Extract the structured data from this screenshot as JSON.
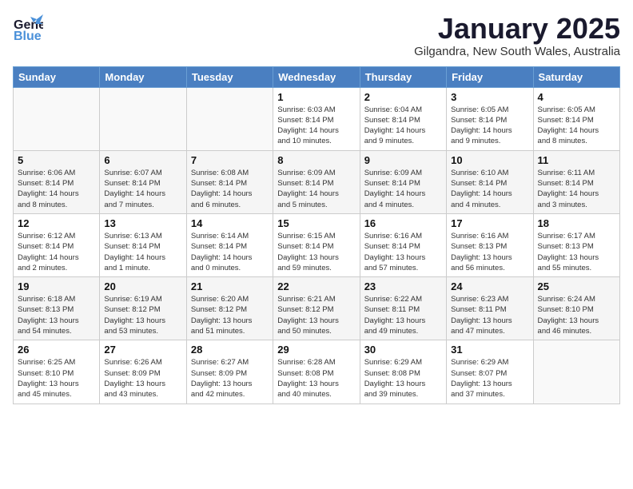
{
  "header": {
    "logo_line1": "General",
    "logo_line2": "Blue",
    "month": "January 2025",
    "location": "Gilgandra, New South Wales, Australia"
  },
  "weekdays": [
    "Sunday",
    "Monday",
    "Tuesday",
    "Wednesday",
    "Thursday",
    "Friday",
    "Saturday"
  ],
  "weeks": [
    [
      {
        "day": "",
        "info": ""
      },
      {
        "day": "",
        "info": ""
      },
      {
        "day": "",
        "info": ""
      },
      {
        "day": "1",
        "info": "Sunrise: 6:03 AM\nSunset: 8:14 PM\nDaylight: 14 hours\nand 10 minutes."
      },
      {
        "day": "2",
        "info": "Sunrise: 6:04 AM\nSunset: 8:14 PM\nDaylight: 14 hours\nand 9 minutes."
      },
      {
        "day": "3",
        "info": "Sunrise: 6:05 AM\nSunset: 8:14 PM\nDaylight: 14 hours\nand 9 minutes."
      },
      {
        "day": "4",
        "info": "Sunrise: 6:05 AM\nSunset: 8:14 PM\nDaylight: 14 hours\nand 8 minutes."
      }
    ],
    [
      {
        "day": "5",
        "info": "Sunrise: 6:06 AM\nSunset: 8:14 PM\nDaylight: 14 hours\nand 8 minutes."
      },
      {
        "day": "6",
        "info": "Sunrise: 6:07 AM\nSunset: 8:14 PM\nDaylight: 14 hours\nand 7 minutes."
      },
      {
        "day": "7",
        "info": "Sunrise: 6:08 AM\nSunset: 8:14 PM\nDaylight: 14 hours\nand 6 minutes."
      },
      {
        "day": "8",
        "info": "Sunrise: 6:09 AM\nSunset: 8:14 PM\nDaylight: 14 hours\nand 5 minutes."
      },
      {
        "day": "9",
        "info": "Sunrise: 6:09 AM\nSunset: 8:14 PM\nDaylight: 14 hours\nand 4 minutes."
      },
      {
        "day": "10",
        "info": "Sunrise: 6:10 AM\nSunset: 8:14 PM\nDaylight: 14 hours\nand 4 minutes."
      },
      {
        "day": "11",
        "info": "Sunrise: 6:11 AM\nSunset: 8:14 PM\nDaylight: 14 hours\nand 3 minutes."
      }
    ],
    [
      {
        "day": "12",
        "info": "Sunrise: 6:12 AM\nSunset: 8:14 PM\nDaylight: 14 hours\nand 2 minutes."
      },
      {
        "day": "13",
        "info": "Sunrise: 6:13 AM\nSunset: 8:14 PM\nDaylight: 14 hours\nand 1 minute."
      },
      {
        "day": "14",
        "info": "Sunrise: 6:14 AM\nSunset: 8:14 PM\nDaylight: 14 hours\nand 0 minutes."
      },
      {
        "day": "15",
        "info": "Sunrise: 6:15 AM\nSunset: 8:14 PM\nDaylight: 13 hours\nand 59 minutes."
      },
      {
        "day": "16",
        "info": "Sunrise: 6:16 AM\nSunset: 8:14 PM\nDaylight: 13 hours\nand 57 minutes."
      },
      {
        "day": "17",
        "info": "Sunrise: 6:16 AM\nSunset: 8:13 PM\nDaylight: 13 hours\nand 56 minutes."
      },
      {
        "day": "18",
        "info": "Sunrise: 6:17 AM\nSunset: 8:13 PM\nDaylight: 13 hours\nand 55 minutes."
      }
    ],
    [
      {
        "day": "19",
        "info": "Sunrise: 6:18 AM\nSunset: 8:13 PM\nDaylight: 13 hours\nand 54 minutes."
      },
      {
        "day": "20",
        "info": "Sunrise: 6:19 AM\nSunset: 8:12 PM\nDaylight: 13 hours\nand 53 minutes."
      },
      {
        "day": "21",
        "info": "Sunrise: 6:20 AM\nSunset: 8:12 PM\nDaylight: 13 hours\nand 51 minutes."
      },
      {
        "day": "22",
        "info": "Sunrise: 6:21 AM\nSunset: 8:12 PM\nDaylight: 13 hours\nand 50 minutes."
      },
      {
        "day": "23",
        "info": "Sunrise: 6:22 AM\nSunset: 8:11 PM\nDaylight: 13 hours\nand 49 minutes."
      },
      {
        "day": "24",
        "info": "Sunrise: 6:23 AM\nSunset: 8:11 PM\nDaylight: 13 hours\nand 47 minutes."
      },
      {
        "day": "25",
        "info": "Sunrise: 6:24 AM\nSunset: 8:10 PM\nDaylight: 13 hours\nand 46 minutes."
      }
    ],
    [
      {
        "day": "26",
        "info": "Sunrise: 6:25 AM\nSunset: 8:10 PM\nDaylight: 13 hours\nand 45 minutes."
      },
      {
        "day": "27",
        "info": "Sunrise: 6:26 AM\nSunset: 8:09 PM\nDaylight: 13 hours\nand 43 minutes."
      },
      {
        "day": "28",
        "info": "Sunrise: 6:27 AM\nSunset: 8:09 PM\nDaylight: 13 hours\nand 42 minutes."
      },
      {
        "day": "29",
        "info": "Sunrise: 6:28 AM\nSunset: 8:08 PM\nDaylight: 13 hours\nand 40 minutes."
      },
      {
        "day": "30",
        "info": "Sunrise: 6:29 AM\nSunset: 8:08 PM\nDaylight: 13 hours\nand 39 minutes."
      },
      {
        "day": "31",
        "info": "Sunrise: 6:29 AM\nSunset: 8:07 PM\nDaylight: 13 hours\nand 37 minutes."
      },
      {
        "day": "",
        "info": ""
      }
    ]
  ]
}
